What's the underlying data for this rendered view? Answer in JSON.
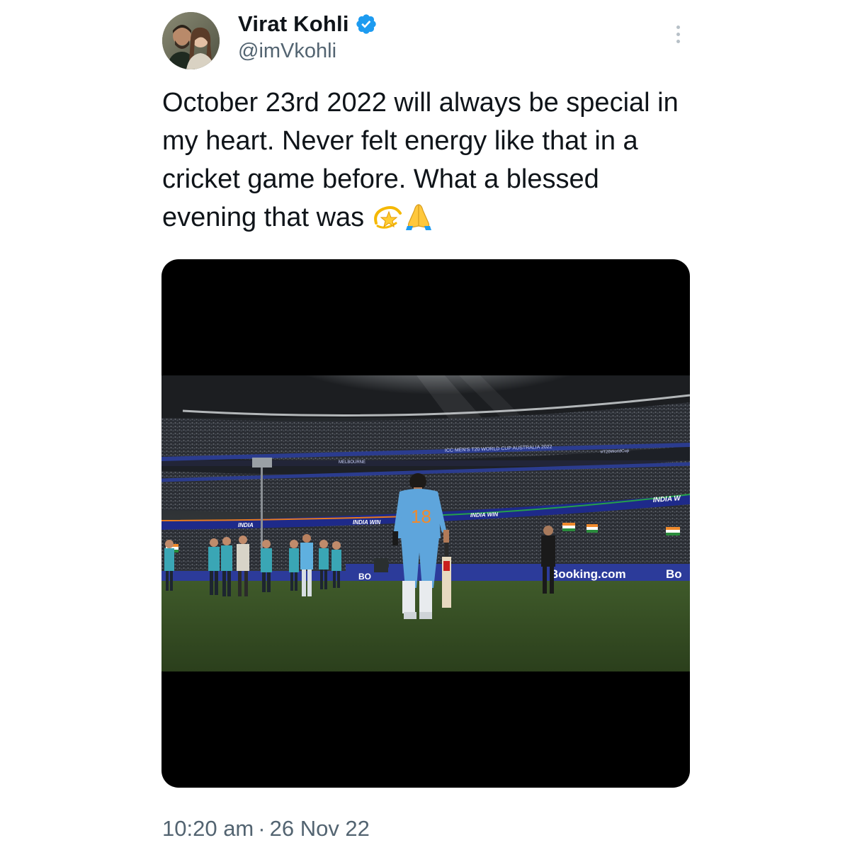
{
  "author": {
    "display_name": "Virat Kohli",
    "handle": "@imVkohli",
    "verified": true,
    "verified_color": "#1d9bf0"
  },
  "icons": {
    "verified": "verified-badge-icon",
    "more": "more-options-icon",
    "emoji_1": "dizzy-star-emoji",
    "emoji_2": "folded-hands-emoji"
  },
  "tweet": {
    "text": "October 23rd 2022 will always be special in my heart. Never felt energy like that in a cricket game before. What a blessed evening that was"
  },
  "media": {
    "signage": {
      "india_win_1": "INDIA WIN",
      "india_win_2": "INDIA WIN",
      "india_right": "INDIA W",
      "india_left": "INDIA",
      "booking": "Booking.com",
      "booking_partial": "Bo",
      "booking_left": "BO",
      "world_cup": "ICC MEN'S T20 WORLD CUP AUSTRALIA 2022",
      "melbourne": "MELBOURNE",
      "t20_tag": "#T20WorldCup",
      "jersey_number": "18"
    }
  },
  "footer": {
    "time": "10:20 am",
    "separator": "·",
    "date": "26 Nov 22"
  }
}
